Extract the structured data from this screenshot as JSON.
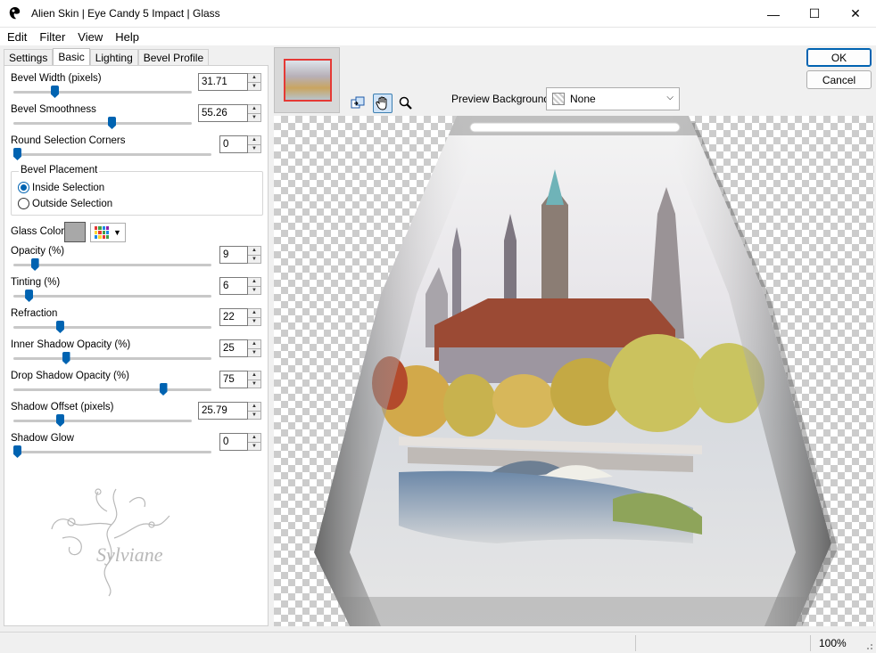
{
  "window": {
    "title": "Alien Skin | Eye Candy 5 Impact | Glass",
    "minimize": "—",
    "maximize": "☐",
    "close": "✕"
  },
  "menu": [
    "Edit",
    "Filter",
    "View",
    "Help"
  ],
  "tabs": [
    "Settings",
    "Basic",
    "Lighting",
    "Bevel Profile"
  ],
  "active_tab": "Basic",
  "controls": {
    "bevel_width": {
      "label": "Bevel Width (pixels)",
      "value": "31.71",
      "level": 0.23
    },
    "bevel_smoothness": {
      "label": "Bevel Smoothness",
      "value": "55.26",
      "level": 0.55
    },
    "round_corners": {
      "label": "Round Selection Corners",
      "value": "0",
      "level": 0.0
    },
    "bevel_placement": {
      "label": "Bevel Placement",
      "options": [
        "Inside Selection",
        "Outside Selection"
      ],
      "selected": "Inside Selection"
    },
    "glass_color": {
      "label": "Glass Color",
      "color": "#a8a8a8"
    },
    "opacity": {
      "label": "Opacity (%)",
      "value": "9",
      "level": 0.09
    },
    "tinting": {
      "label": "Tinting (%)",
      "value": "6",
      "level": 0.06
    },
    "refraction": {
      "label": "Refraction",
      "value": "22",
      "level": 0.22
    },
    "inner_shadow_opacity": {
      "label": "Inner Shadow Opacity (%)",
      "value": "25",
      "level": 0.25
    },
    "drop_shadow_opacity": {
      "label": "Drop Shadow Opacity (%)",
      "value": "75",
      "level": 0.75
    },
    "shadow_offset": {
      "label": "Shadow Offset (pixels)",
      "value": "25.79",
      "level": 0.26
    },
    "shadow_glow": {
      "label": "Shadow Glow",
      "value": "0",
      "level": 0.0
    }
  },
  "watermark_text": "Sylviane",
  "preview": {
    "background_label": "Preview Background:",
    "background_value": "None"
  },
  "buttons": {
    "ok": "OK",
    "cancel": "Cancel"
  },
  "status": {
    "zoom": "100%"
  },
  "icons": [
    "app-logo-icon",
    "navigate-icon",
    "hand-pan-icon",
    "zoom-icon"
  ]
}
